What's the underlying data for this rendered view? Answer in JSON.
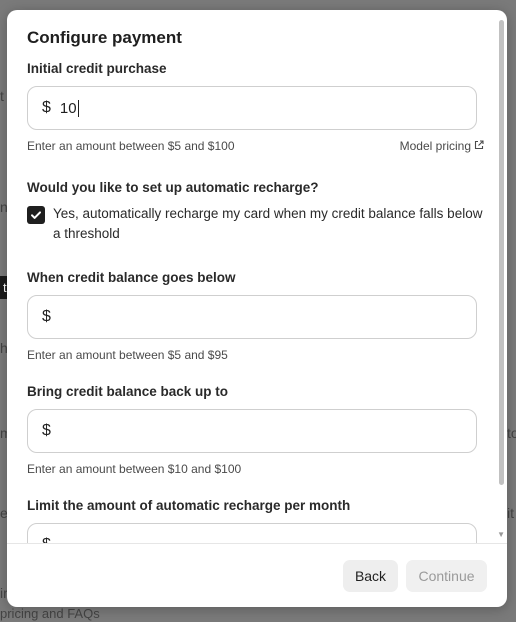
{
  "background": {
    "frag_t": "t",
    "frag_ng": "ng",
    "frag_h": "h",
    "frag_m": "m",
    "frag_e": "e",
    "frag_ir": "ir",
    "frag_pricing": "pricing and FAQs",
    "frag_to": "to",
    "frag_it": "it",
    "frag_y": "y"
  },
  "modal": {
    "title": "Configure payment",
    "initial": {
      "label": "Initial credit purchase",
      "currency": "$",
      "value": "10",
      "hint": "Enter an amount between $5 and $100",
      "link": "Model pricing"
    },
    "auto": {
      "question": "Would you like to set up automatic recharge?",
      "checkbox_label": "Yes, automatically recharge my card when my credit balance falls below a threshold",
      "checked": true
    },
    "below": {
      "label": "When credit balance goes below",
      "currency": "$",
      "value": "",
      "hint": "Enter an amount between $5 and $95"
    },
    "back_up": {
      "label": "Bring credit balance back up to",
      "currency": "$",
      "value": "",
      "hint": "Enter an amount between $10 and $100"
    },
    "limit": {
      "label": "Limit the amount of automatic recharge per month",
      "currency": "$",
      "value": ""
    },
    "buttons": {
      "back": "Back",
      "continue": "Continue"
    }
  },
  "colors": {
    "accent": "#1f1f1f",
    "overlay": "#7a7a7a",
    "disabled_text": "#9a9a9a"
  },
  "icons": {
    "checkbox": "check-icon",
    "link": "external-link-icon"
  }
}
